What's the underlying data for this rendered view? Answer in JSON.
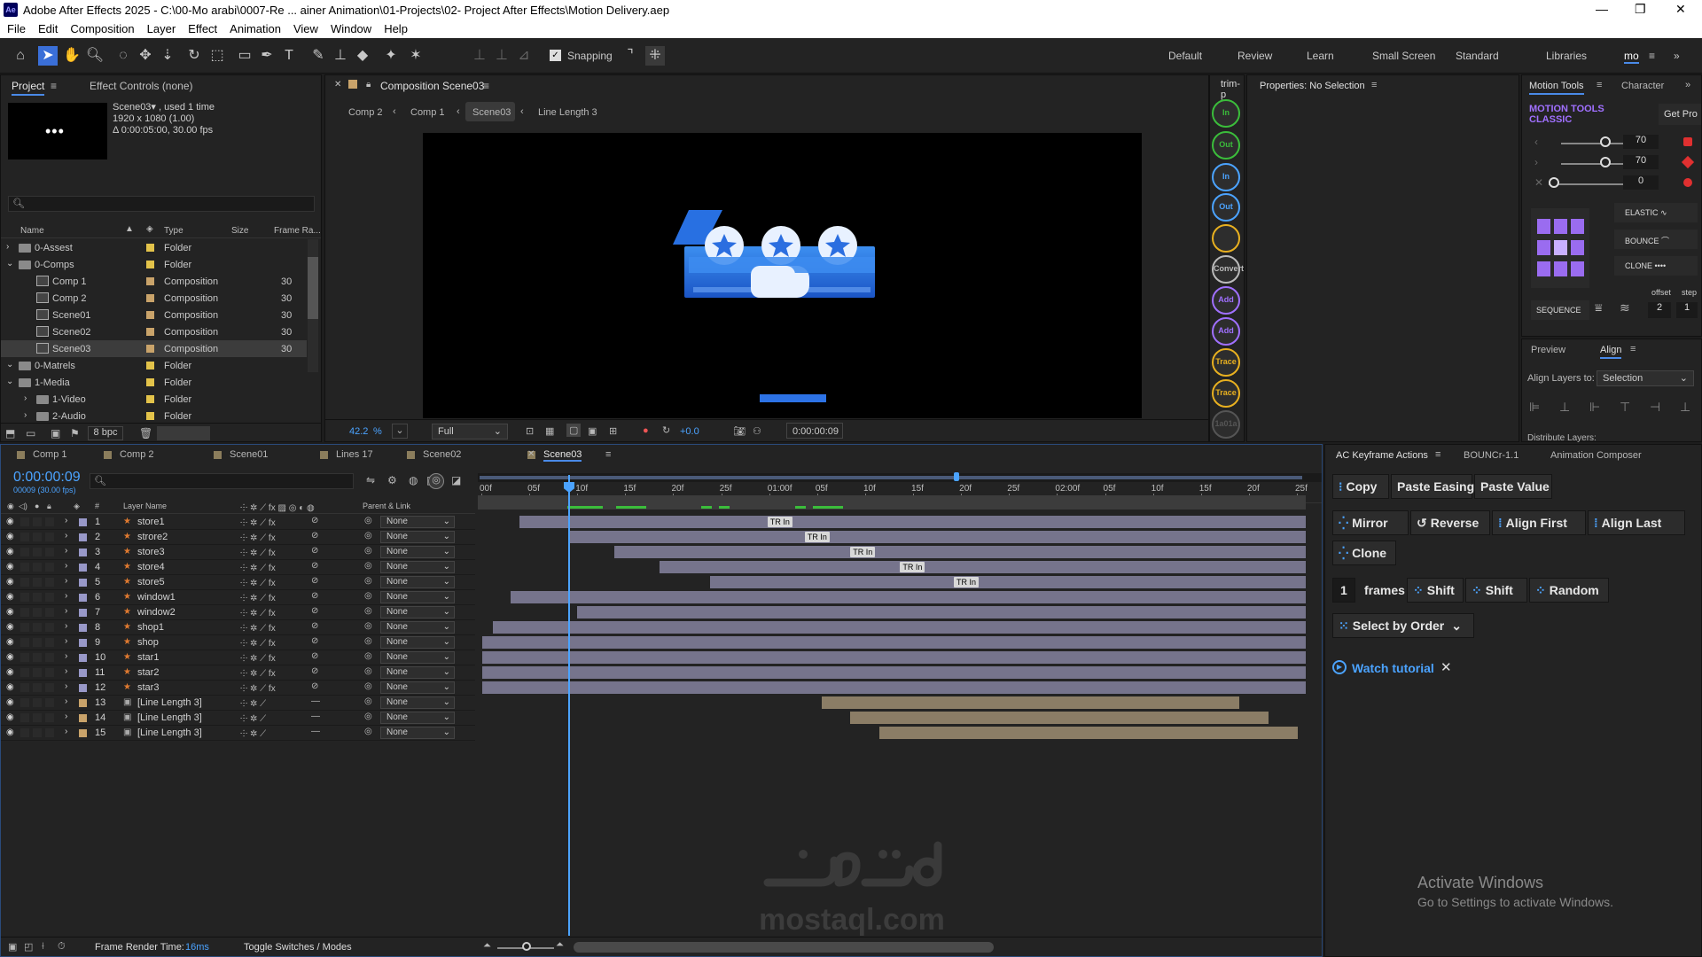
{
  "app": {
    "title": "Adobe After Effects 2025 - C:\\00-Mo arabi\\0007-Re ... ainer Animation\\01-Projects\\02- Project After Effects\\Motion Delivery.aep",
    "logo": "Ae"
  },
  "menu": [
    "File",
    "Edit",
    "Composition",
    "Layer",
    "Effect",
    "Animation",
    "View",
    "Window",
    "Help"
  ],
  "toolbar": {
    "snapping": "Snapping",
    "workspaces": [
      "Default",
      "Review",
      "Learn",
      "Small Screen",
      "Standard",
      "Libraries",
      "mo"
    ]
  },
  "project": {
    "tab": "Project",
    "effect_controls": "Effect Controls (none)",
    "thumb_name": "Scene03▾ , used 1 time",
    "thumb_size": "1920 x 1080 (1.00)",
    "thumb_dur": "Δ 0:00:05:00, 30.00 fps",
    "columns": [
      "Name",
      "Type",
      "Size",
      "Frame Ra..."
    ],
    "items": [
      {
        "name": "0-Assest",
        "type": "Folder",
        "rate": "",
        "kind": "folder",
        "indent": 0,
        "open": false
      },
      {
        "name": "0-Comps",
        "type": "Folder",
        "rate": "",
        "kind": "folder",
        "indent": 0,
        "open": true
      },
      {
        "name": "Comp 1",
        "type": "Composition",
        "rate": "30",
        "kind": "comp",
        "indent": 1
      },
      {
        "name": "Comp 2",
        "type": "Composition",
        "rate": "30",
        "kind": "comp",
        "indent": 1
      },
      {
        "name": "Scene01",
        "type": "Composition",
        "rate": "30",
        "kind": "comp",
        "indent": 1
      },
      {
        "name": "Scene02",
        "type": "Composition",
        "rate": "30",
        "kind": "comp",
        "indent": 1
      },
      {
        "name": "Scene03",
        "type": "Composition",
        "rate": "30",
        "kind": "comp",
        "indent": 1,
        "selected": true
      },
      {
        "name": "0-Matrels",
        "type": "Folder",
        "rate": "",
        "kind": "folder",
        "indent": 0,
        "open": true
      },
      {
        "name": "1-Media",
        "type": "Folder",
        "rate": "",
        "kind": "folder",
        "indent": 0,
        "open": true
      },
      {
        "name": "1-Video",
        "type": "Folder",
        "rate": "",
        "kind": "folder",
        "indent": 1,
        "open": false
      },
      {
        "name": "2-Audio",
        "type": "Folder",
        "rate": "",
        "kind": "folder",
        "indent": 1,
        "open": false
      }
    ],
    "bpc": "8 bpc"
  },
  "viewer": {
    "tab": "Composition Scene03",
    "breadcrumbs": [
      "Comp 2",
      "Comp 1",
      "Scene03",
      "Line Length 3"
    ],
    "zoom": "42.2",
    "zoom_unit": "%",
    "resolution": "Full",
    "exposure": "+0.0",
    "timecode": "0:00:00:09"
  },
  "mt_side": {
    "tab": "trim-p",
    "buttons": [
      "In",
      "Out",
      "In",
      "Out",
      "",
      "Convert",
      "Add",
      "Add",
      "Trace In",
      "Trace Out",
      "1a01a"
    ]
  },
  "properties": {
    "title": "Properties: No Selection"
  },
  "motion_tools": {
    "tabs": [
      "Motion Tools",
      "Character"
    ],
    "brand": "MOTION TOOLS",
    "brand2": "CLASSIC",
    "get_pro": "Get Pro",
    "values": [
      "70",
      "70",
      "0"
    ],
    "elastic": "ELASTIC",
    "bounce": "BOUNCE",
    "clone": "CLONE",
    "offset": "offset",
    "step": "step",
    "sequence": "SEQUENCE",
    "seq_offset": "2",
    "seq_step": "1"
  },
  "align": {
    "tabs": [
      "Preview",
      "Align"
    ],
    "label": "Align Layers to:",
    "value": "Selection",
    "distribute": "Distribute Layers:"
  },
  "timeline": {
    "tabs": [
      "Comp 1",
      "Comp 2",
      "Scene01",
      "Lines 17",
      "Scene02",
      "Scene03"
    ],
    "tab_colors": [
      "#8b7d5c",
      "#8b7d5c",
      "#8b7d5c",
      "#8b7d5c",
      "#8b7d5c",
      "#8b7d5c"
    ],
    "timecode": "0:00:00:09",
    "sub": "00009 (30.00 fps)",
    "col_layer": "Layer Name",
    "col_parent": "Parent & Link",
    "ruler": [
      "00f",
      "05f",
      "10f",
      "15f",
      "20f",
      "25f",
      "01:00f",
      "05f",
      "10f",
      "15f",
      "20f",
      "25f",
      "02:00f",
      "05f",
      "10f",
      "15f",
      "20f",
      "25f"
    ],
    "layers": [
      {
        "num": "1",
        "name": "store1",
        "parent": "None",
        "color": "#9898c8",
        "start": 0.05,
        "end": 1.0,
        "kf": "TR In",
        "kfpos": 0.35
      },
      {
        "num": "2",
        "name": "strore2",
        "parent": "None",
        "color": "#9898c8",
        "start": 0.11,
        "end": 1.0,
        "kf": "TR In",
        "kfpos": 0.395
      },
      {
        "num": "3",
        "name": "store3",
        "parent": "None",
        "color": "#9898c8",
        "start": 0.165,
        "end": 1.0,
        "kf": "TR In",
        "kfpos": 0.45
      },
      {
        "num": "4",
        "name": "store4",
        "parent": "None",
        "color": "#9898c8",
        "start": 0.22,
        "end": 1.0,
        "kf": "TR In",
        "kfpos": 0.51
      },
      {
        "num": "5",
        "name": "store5",
        "parent": "None",
        "color": "#9898c8",
        "start": 0.28,
        "end": 1.0,
        "kf": "TR In",
        "kfpos": 0.575
      },
      {
        "num": "6",
        "name": "window1",
        "parent": "None",
        "color": "#9898c8",
        "start": 0.04,
        "end": 1.0
      },
      {
        "num": "7",
        "name": "window2",
        "parent": "None",
        "color": "#9898c8",
        "start": 0.12,
        "end": 1.0
      },
      {
        "num": "8",
        "name": "shop1",
        "parent": "None",
        "color": "#9898c8",
        "start": 0.018,
        "end": 1.0
      },
      {
        "num": "9",
        "name": "shop",
        "parent": "None",
        "color": "#9898c8",
        "start": 0.005,
        "end": 1.0
      },
      {
        "num": "10",
        "name": "star1",
        "parent": "None",
        "color": "#9898c8",
        "start": 0.005,
        "end": 1.0
      },
      {
        "num": "11",
        "name": "star2",
        "parent": "None",
        "color": "#9898c8",
        "start": 0.005,
        "end": 1.0
      },
      {
        "num": "12",
        "name": "star3",
        "parent": "None",
        "color": "#9898c8",
        "start": 0.005,
        "end": 1.0
      },
      {
        "num": "13",
        "name": "[Line Length 3]",
        "parent": "None",
        "color": "#c9a36a",
        "start": 0.415,
        "end": 0.92,
        "tan": true
      },
      {
        "num": "14",
        "name": "[Line Length 3]",
        "parent": "None",
        "color": "#c9a36a",
        "start": 0.45,
        "end": 0.955,
        "tan": true
      },
      {
        "num": "15",
        "name": "[Line Length 3]",
        "parent": "None",
        "color": "#c9a36a",
        "start": 0.485,
        "end": 0.99,
        "tan": true
      }
    ],
    "render_label": "Frame Render Time:",
    "render_value": "16ms",
    "toggle": "Toggle Switches / Modes"
  },
  "ac": {
    "tabs": [
      "AC Keyframe Actions",
      "BOUNCr-1.1",
      "Animation Composer"
    ],
    "copy": "Copy",
    "paste_easing": "Paste Easing",
    "paste_value": "Paste Value",
    "mirror": "Mirror",
    "reverse": "Reverse",
    "align_first": "Align First",
    "align_last": "Align Last",
    "clone": "Clone",
    "frames_n": "1",
    "frames": "frames",
    "shift1": "Shift",
    "shift2": "Shift",
    "random": "Random",
    "select_by": "Select by Order",
    "watch": "Watch tutorial"
  },
  "watermark": {
    "text": "mostaql.com"
  },
  "activate": {
    "title": "Activate Windows",
    "sub": "Go to Settings to activate Windows."
  }
}
